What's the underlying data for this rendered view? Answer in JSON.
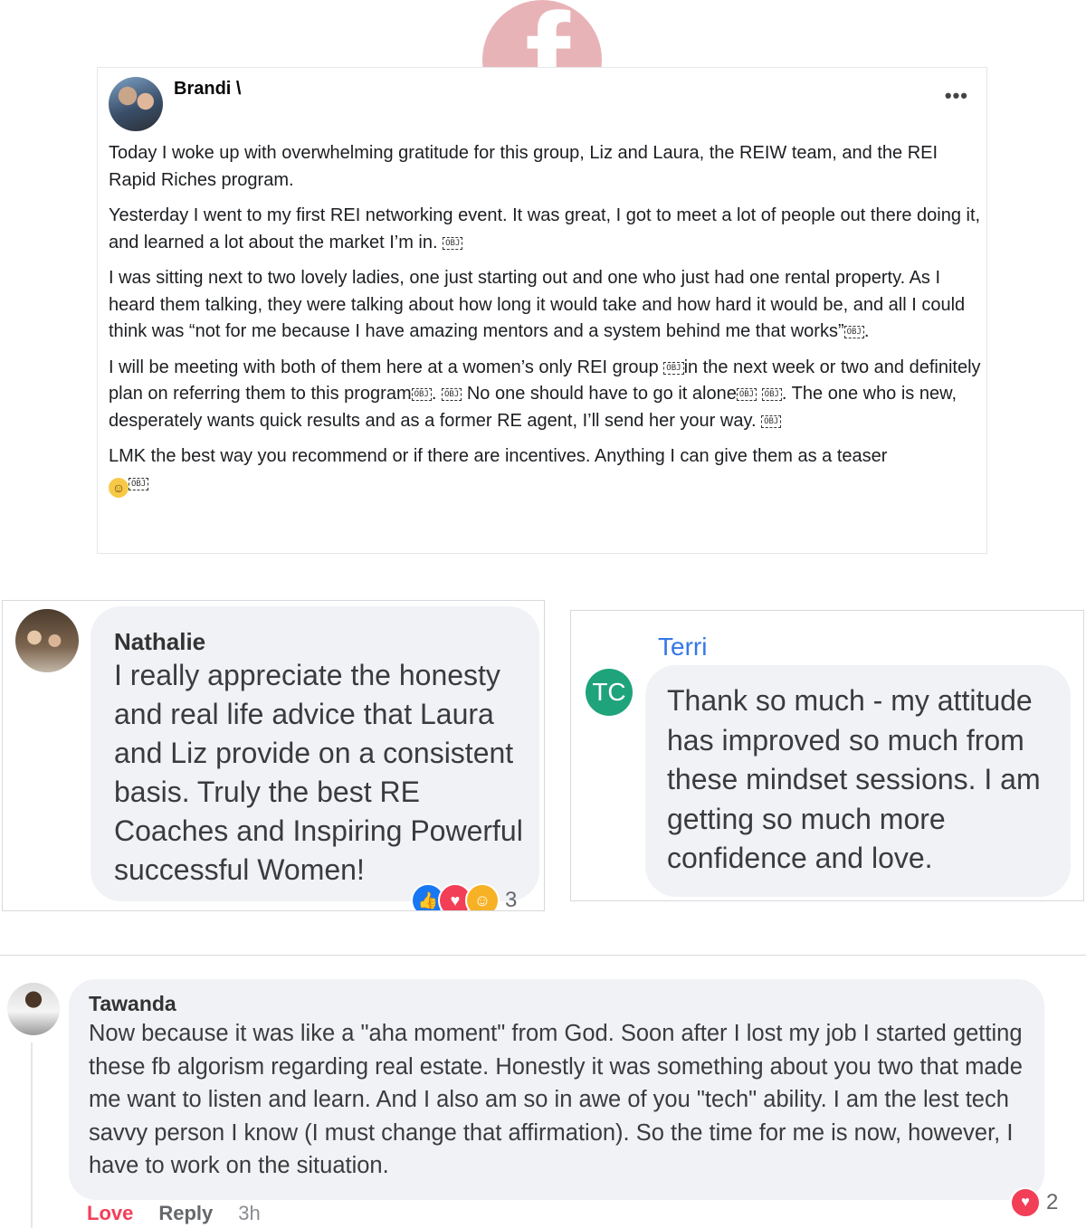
{
  "logo": {
    "glyph": "f",
    "color": "#e8b3b7"
  },
  "post": {
    "author": "Brandi \\",
    "more_label": "•••",
    "paragraphs": [
      "Today I woke up with overwhelming gratitude for this group, Liz and Laura, the REIW team, and the REI Rapid Riches program.",
      "Yesterday I went to my first REI networking event.  It was great, I got to meet a lot of people out there doing it, and learned a lot about the market I’m in.",
      "I was sitting next to two lovely ladies, one just starting out and one who just had one rental property. As I heard them talking, they were talking about how long it would take and how hard it would be, and all I could think was “not for me because I have amazing mentors and a system behind me that works”",
      "I will be meeting with both of them here at a women’s only REI group",
      "in the next week or two and definitely plan on referring them to this program",
      "No one should have to go it alone",
      ". The one who is new, desperately wants quick results and as a former RE agent, I’ll send her your way.",
      "LMK the best way you recommend or if there are incentives. Anything I can give them as a teaser"
    ],
    "obj_label": "OBJ",
    "emoji": "☺"
  },
  "comments": {
    "nathalie": {
      "name": "Nathalie",
      "text": "I really appreciate the honesty and real life advice that Laura and Liz provide on a consistent basis. Truly the best RE Coaches and Inspiring Powerful successful Women!",
      "reaction_count": "3"
    },
    "terri": {
      "name": "Terri",
      "initials": "TC",
      "text": "Thank so much - my attitude has improved so much from these mindset sessions.  I am getting so much more confidence and love."
    },
    "tawanda": {
      "name": "Tawanda",
      "text": "Now because it was like a \"aha moment\" from God. Soon after I lost my job I started getting these fb algorism regarding real estate. Honestly it was something about you two that made me want to listen and learn. And I also am so in awe of you \"tech\" ability. I am the lest tech savvy person I know (I must change that affirmation). So the time for me is now, however, I have to work on the situation.",
      "actions": {
        "love": "Love",
        "reply": "Reply",
        "time": "3h"
      },
      "reaction_count": "2"
    }
  },
  "icons": {
    "like": "thumbs-up-icon",
    "love": "heart-icon",
    "care": "care-icon"
  },
  "colors": {
    "link_blue": "#3578e5",
    "love_red": "#f33e58",
    "like_blue": "#1877f2",
    "bubble_grey": "#f0f2f5",
    "avatar_green": "#1fa37a"
  }
}
